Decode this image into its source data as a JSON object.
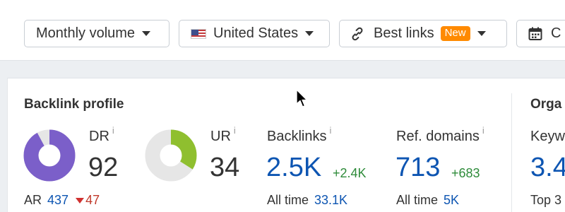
{
  "toolbar": {
    "volume": {
      "label": "Monthly volume"
    },
    "country": {
      "label": "United States"
    },
    "links": {
      "label": "Best links",
      "badge": "New"
    },
    "date": {
      "label": "C"
    }
  },
  "backlink_profile": {
    "title": "Backlink profile",
    "dr": {
      "label": "DR",
      "info": "i",
      "value": "92",
      "gauge_fraction": 0.92,
      "color": "#7b5fc9"
    },
    "ur": {
      "label": "UR",
      "info": "i",
      "value": "34",
      "gauge_fraction": 0.34,
      "color": "#8fbf2f"
    },
    "ar": {
      "label": "AR",
      "value": "437",
      "change": "47"
    },
    "backlinks": {
      "label": "Backlinks",
      "info": "i",
      "value": "2.5K",
      "delta": "+2.4K",
      "sub_label": "All time",
      "sub_value": "33.1K"
    },
    "ref_domains": {
      "label": "Ref. domains",
      "info": "i",
      "value": "713",
      "delta": "+683",
      "sub_label": "All time",
      "sub_value": "5K"
    }
  },
  "organic": {
    "title": "Orga",
    "keywords_label": "Keyw",
    "value": "3.4",
    "sub_label": "Top 3"
  },
  "colors": {
    "accent_blue": "#0d55b2",
    "positive": "#2e8b3a",
    "negative": "#d0302f",
    "badge": "#ff8a00"
  },
  "icons": {
    "flag": "us-flag-icon",
    "link": "link-icon",
    "calendar": "calendar-icon",
    "cursor": "mouse-cursor"
  }
}
